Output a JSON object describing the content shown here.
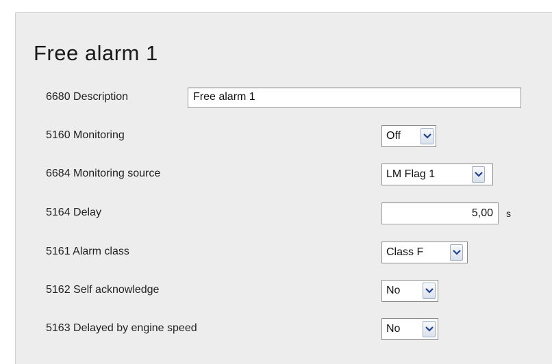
{
  "page": {
    "title": "Free alarm 1"
  },
  "fields": {
    "description": {
      "label": "6680 Description",
      "value": "Free alarm 1"
    },
    "monitoring": {
      "label": "5160 Monitoring",
      "value": "Off"
    },
    "monitoring_source": {
      "label": "6684 Monitoring source",
      "value": "LM Flag 1"
    },
    "delay": {
      "label": "5164 Delay",
      "value": "5,00",
      "unit": "s"
    },
    "alarm_class": {
      "label": "5161 Alarm class",
      "value": "Class F"
    },
    "self_acknowledge": {
      "label": "5162 Self acknowledge",
      "value": "No"
    },
    "delayed_by_engine_speed": {
      "label": "5163 Delayed by engine speed",
      "value": "No"
    }
  },
  "icons": {
    "dropdown": "chevron-down-icon"
  },
  "colors": {
    "panel_background": "#ededed",
    "dropdown_accent": "#1f3f8f"
  }
}
